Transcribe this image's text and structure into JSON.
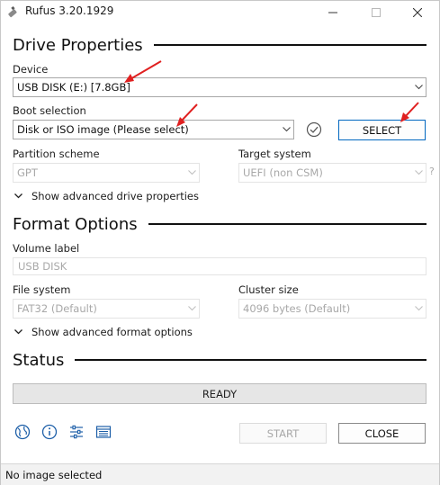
{
  "window": {
    "title": "Rufus 3.20.1929"
  },
  "drive_properties": {
    "header": "Drive Properties",
    "device_label": "Device",
    "device_value": "USB DISK (E:) [7.8GB]",
    "boot_label": "Boot selection",
    "boot_value": "Disk or ISO image (Please select)",
    "select_button": "SELECT",
    "partition_label": "Partition scheme",
    "partition_value": "GPT",
    "target_label": "Target system",
    "target_value": "UEFI (non CSM)",
    "help_mark": "?",
    "advanced_toggle": "Show advanced drive properties"
  },
  "format_options": {
    "header": "Format Options",
    "volume_label": "Volume label",
    "volume_value": "USB DISK",
    "fs_label": "File system",
    "fs_value": "FAT32 (Default)",
    "cluster_label": "Cluster size",
    "cluster_value": "4096 bytes (Default)",
    "advanced_toggle": "Show advanced format options"
  },
  "status": {
    "header": "Status",
    "progress_text": "READY"
  },
  "actions": {
    "start_button": "START",
    "close_button": "CLOSE"
  },
  "toolbar_icons": [
    "globe-icon",
    "info-icon",
    "settings-sliders-icon",
    "log-icon"
  ],
  "statusbar": {
    "text": "No image selected"
  },
  "colors": {
    "accent": "#0067c0",
    "annotation_arrow": "#e02020",
    "disabled_text": "#a8a8a8"
  }
}
